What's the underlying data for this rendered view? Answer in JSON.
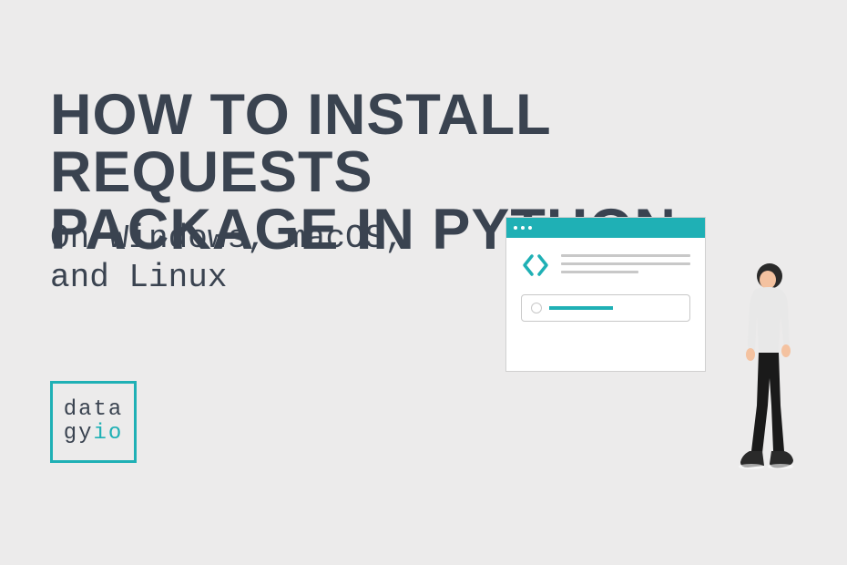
{
  "title": {
    "line1": "HOW TO INSTALL REQUESTS",
    "line2": "PACKAGE IN PYTHON"
  },
  "subtitle": {
    "line1": "On Windows, macOS,",
    "line2": "and Linux"
  },
  "logo": {
    "line1": "data",
    "line2_part1": "gy",
    "line2_part2": "io"
  },
  "colors": {
    "primary": "#1fb0b5",
    "text": "#3a4350",
    "background": "#ecebeb"
  }
}
